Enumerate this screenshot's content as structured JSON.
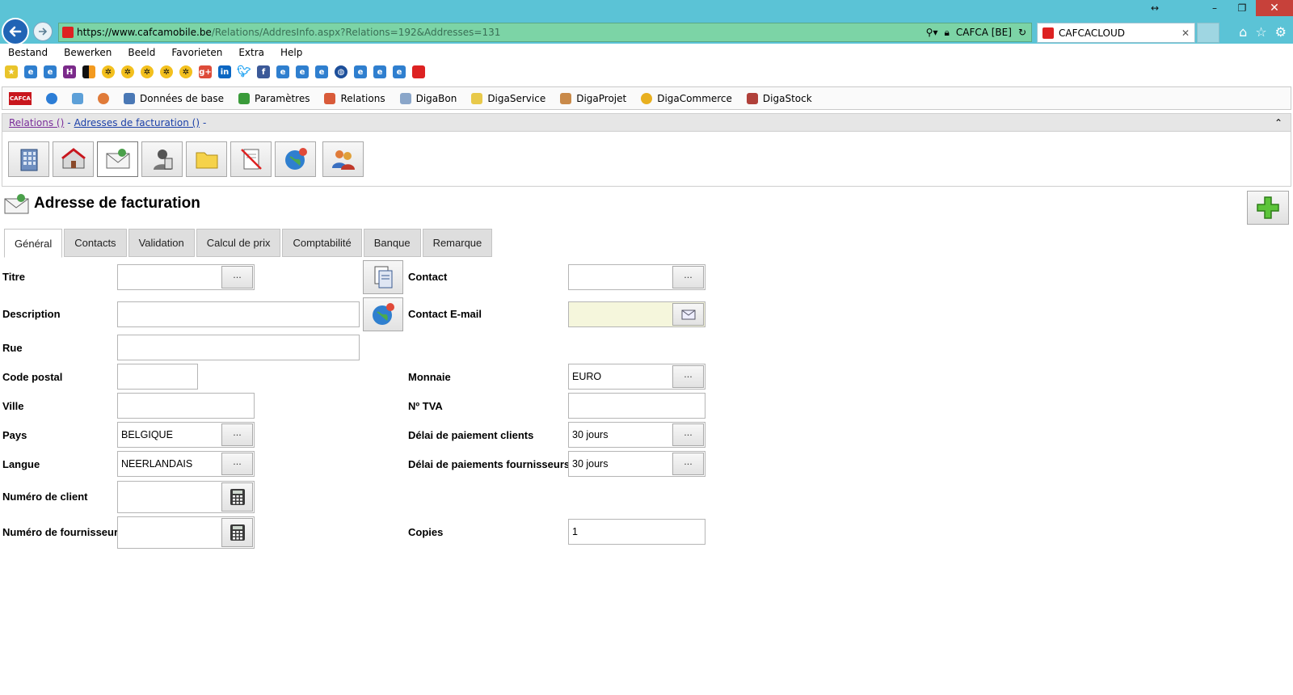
{
  "browser": {
    "url_prefix": "https://www.",
    "url_host": "cafcamobile.be",
    "url_path": "/Relations/AddresInfo.aspx?Relations=192&Addresses=131",
    "site_identity": "CAFCA [BE]",
    "tab_title": "CAFCACLOUD"
  },
  "menu": [
    "Bestand",
    "Bewerken",
    "Beeld",
    "Favorieten",
    "Extra",
    "Help"
  ],
  "app_toolbar": {
    "logo_text": "CAFCA",
    "items": [
      "Données de base",
      "Paramètres",
      "Relations",
      "DigaBon",
      "DigaService",
      "DigaProjet",
      "DigaCommerce",
      "DigaStock"
    ]
  },
  "breadcrumb": {
    "crumb1": "Relations ()",
    "sep": "-",
    "crumb2": "Adresses de facturation ()",
    "trail": "-"
  },
  "page": {
    "title": "Adresse de facturation"
  },
  "tabs": [
    "Général",
    "Contacts",
    "Validation",
    "Calcul de prix",
    "Comptabilité",
    "Banque",
    "Remarque"
  ],
  "form": {
    "dots": "···",
    "left": {
      "titre": {
        "label": "Titre",
        "value": ""
      },
      "description": {
        "label": "Description",
        "value": ""
      },
      "rue": {
        "label": "Rue",
        "value": ""
      },
      "code_postal": {
        "label": "Code postal",
        "value": ""
      },
      "ville": {
        "label": "Ville",
        "value": ""
      },
      "pays": {
        "label": "Pays",
        "value": "BELGIQUE"
      },
      "langue": {
        "label": "Langue",
        "value": "NEERLANDAIS"
      },
      "numero_client": {
        "label": "Numéro de client",
        "value": ""
      },
      "numero_fournisseur": {
        "label": "Numéro de fournisseur",
        "value": ""
      }
    },
    "right": {
      "contact": {
        "label": "Contact",
        "value": ""
      },
      "contact_email": {
        "label": "Contact E-mail",
        "value": ""
      },
      "monnaie": {
        "label": "Monnaie",
        "value": "EURO"
      },
      "tva": {
        "label": "Nº TVA",
        "value": ""
      },
      "delai_clients": {
        "label": "Délai de paiement clients",
        "value": "30 jours"
      },
      "delai_fournisseurs": {
        "label": "Délai de paiements fournisseurs",
        "value": "30 jours"
      },
      "copies": {
        "label": "Copies",
        "value": "1"
      }
    }
  }
}
